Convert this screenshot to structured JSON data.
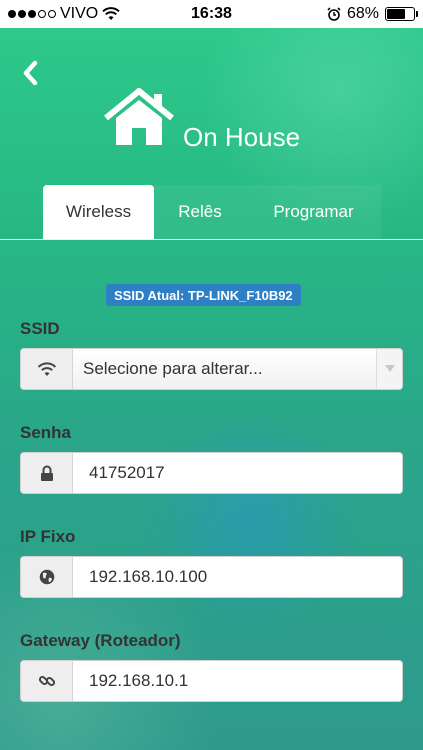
{
  "status_bar": {
    "carrier": "VIVO",
    "time": "16:38",
    "battery": "68%",
    "battery_level": 0.68,
    "signal_bars": 3
  },
  "header": {
    "title": "On House"
  },
  "tabs": [
    {
      "label": "Wireless",
      "active": true
    },
    {
      "label": "Relês",
      "active": false
    },
    {
      "label": "Programar",
      "active": false
    }
  ],
  "ssid_current": "SSID Atual: TP-LINK_F10B92",
  "form": {
    "ssid": {
      "label": "SSID",
      "value": "Selecione para alterar...",
      "icon": "wifi-icon"
    },
    "senha": {
      "label": "Senha",
      "value": "41752017",
      "icon": "lock-icon"
    },
    "ip_fixo": {
      "label": "IP Fixo",
      "value": "192.168.10.100",
      "icon": "globe-icon"
    },
    "gateway": {
      "label": "Gateway (Roteador)",
      "value": "192.168.10.1",
      "icon": "link-icon"
    }
  },
  "colors": {
    "accent_green": "#2ecb8b",
    "badge_blue": "#2f7fc4"
  }
}
